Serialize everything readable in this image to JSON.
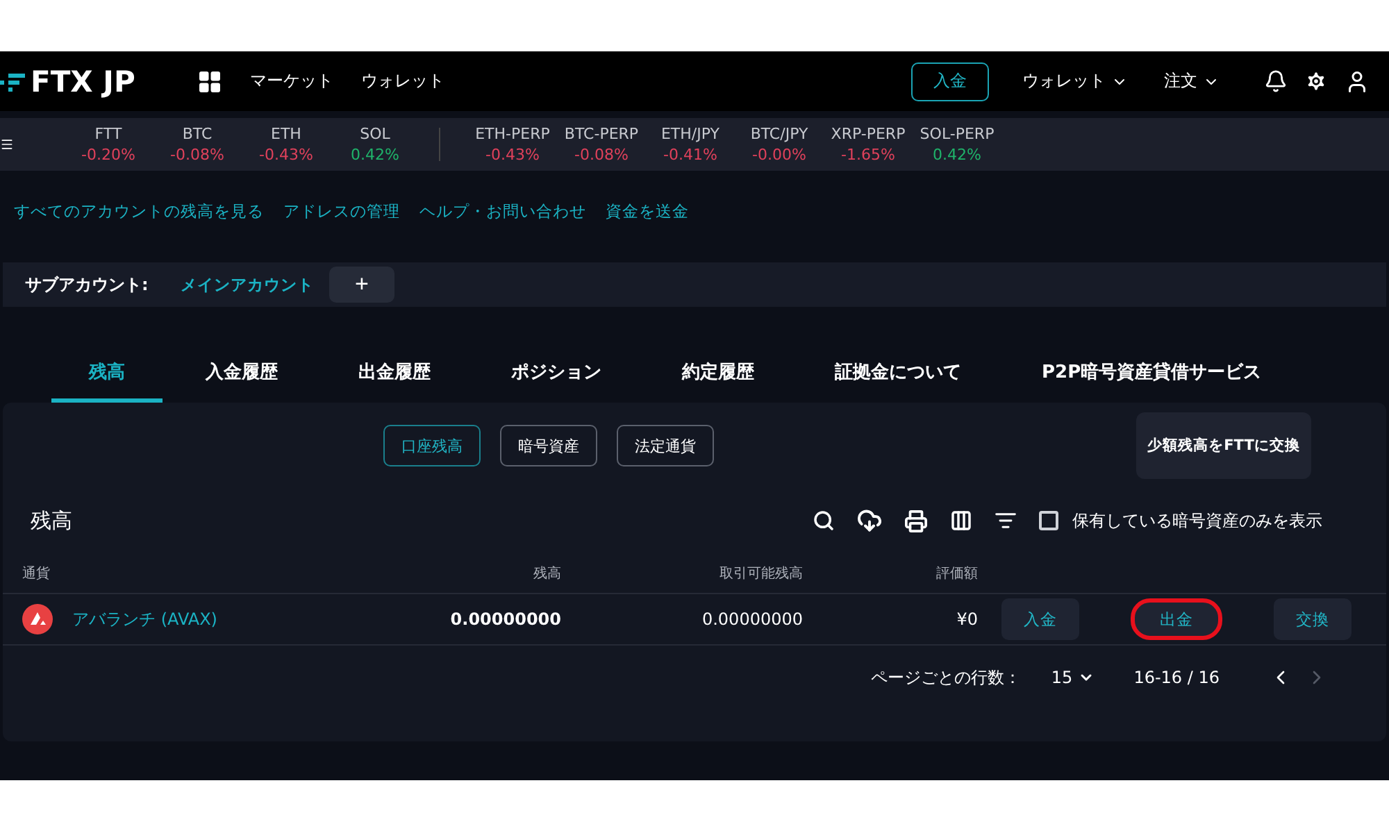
{
  "header": {
    "logo": "FTX JP",
    "nav": [
      "マーケット",
      "ウォレット"
    ],
    "deposit_button": "入金",
    "menus": [
      "ウォレット",
      "注文"
    ]
  },
  "ticker": {
    "groups": [
      [
        {
          "symbol": "FTT",
          "change": "-0.20%",
          "color": "#e0415b"
        },
        {
          "symbol": "BTC",
          "change": "-0.08%",
          "color": "#e0415b"
        },
        {
          "symbol": "ETH",
          "change": "-0.43%",
          "color": "#e0415b"
        },
        {
          "symbol": "SOL",
          "change": "0.42%",
          "color": "#1fb36a"
        }
      ],
      [
        {
          "symbol": "ETH-PERP",
          "change": "-0.43%",
          "color": "#e0415b"
        },
        {
          "symbol": "BTC-PERP",
          "change": "-0.08%",
          "color": "#e0415b"
        },
        {
          "symbol": "ETH/JPY",
          "change": "-0.41%",
          "color": "#e0415b"
        },
        {
          "symbol": "BTC/JPY",
          "change": "-0.00%",
          "color": "#e0415b"
        },
        {
          "symbol": "XRP-PERP",
          "change": "-1.65%",
          "color": "#e0415b"
        },
        {
          "symbol": "SOL-PERP",
          "change": "0.42%",
          "color": "#1fb36a"
        }
      ]
    ]
  },
  "links": [
    "すべてのアカウントの残高を見る",
    "アドレスの管理",
    "ヘルプ・お問い合わせ",
    "資金を送金"
  ],
  "subaccount": {
    "label": "サブアカウント:",
    "account": "メインアカウント",
    "add": "+"
  },
  "tabs": [
    {
      "label": "残高",
      "selected": true
    },
    {
      "label": "入金履歴",
      "selected": false
    },
    {
      "label": "出金履歴",
      "selected": false
    },
    {
      "label": "ポジション",
      "selected": false
    },
    {
      "label": "約定履歴",
      "selected": false
    },
    {
      "label": "証拠金について",
      "selected": false
    },
    {
      "label": "P2P暗号資産貸借サービス",
      "selected": false
    }
  ],
  "filters": [
    {
      "label": "口座残高",
      "selected": true
    },
    {
      "label": "暗号資産",
      "selected": false
    },
    {
      "label": "法定通貨",
      "selected": false
    }
  ],
  "convert_button": "少額残高をFTTに交換",
  "table": {
    "title": "残高",
    "holdings_only": {
      "label": "保有している暗号資産のみを表示",
      "checked": false
    },
    "columns": [
      "通貨",
      "残高",
      "取引可能残高",
      "評価額"
    ],
    "rows": [
      {
        "currency": "アバランチ (AVAX)",
        "balance": "0.00000000",
        "available": "0.00000000",
        "value": "¥0",
        "actions": [
          {
            "label": "入金",
            "highlighted": false
          },
          {
            "label": "出金",
            "highlighted": true
          },
          {
            "label": "交換",
            "highlighted": false
          }
        ]
      }
    ]
  },
  "pagination": {
    "rows_label": "ページごとの行数：",
    "rows_per_page": "15",
    "range": "16-16 / 16"
  }
}
